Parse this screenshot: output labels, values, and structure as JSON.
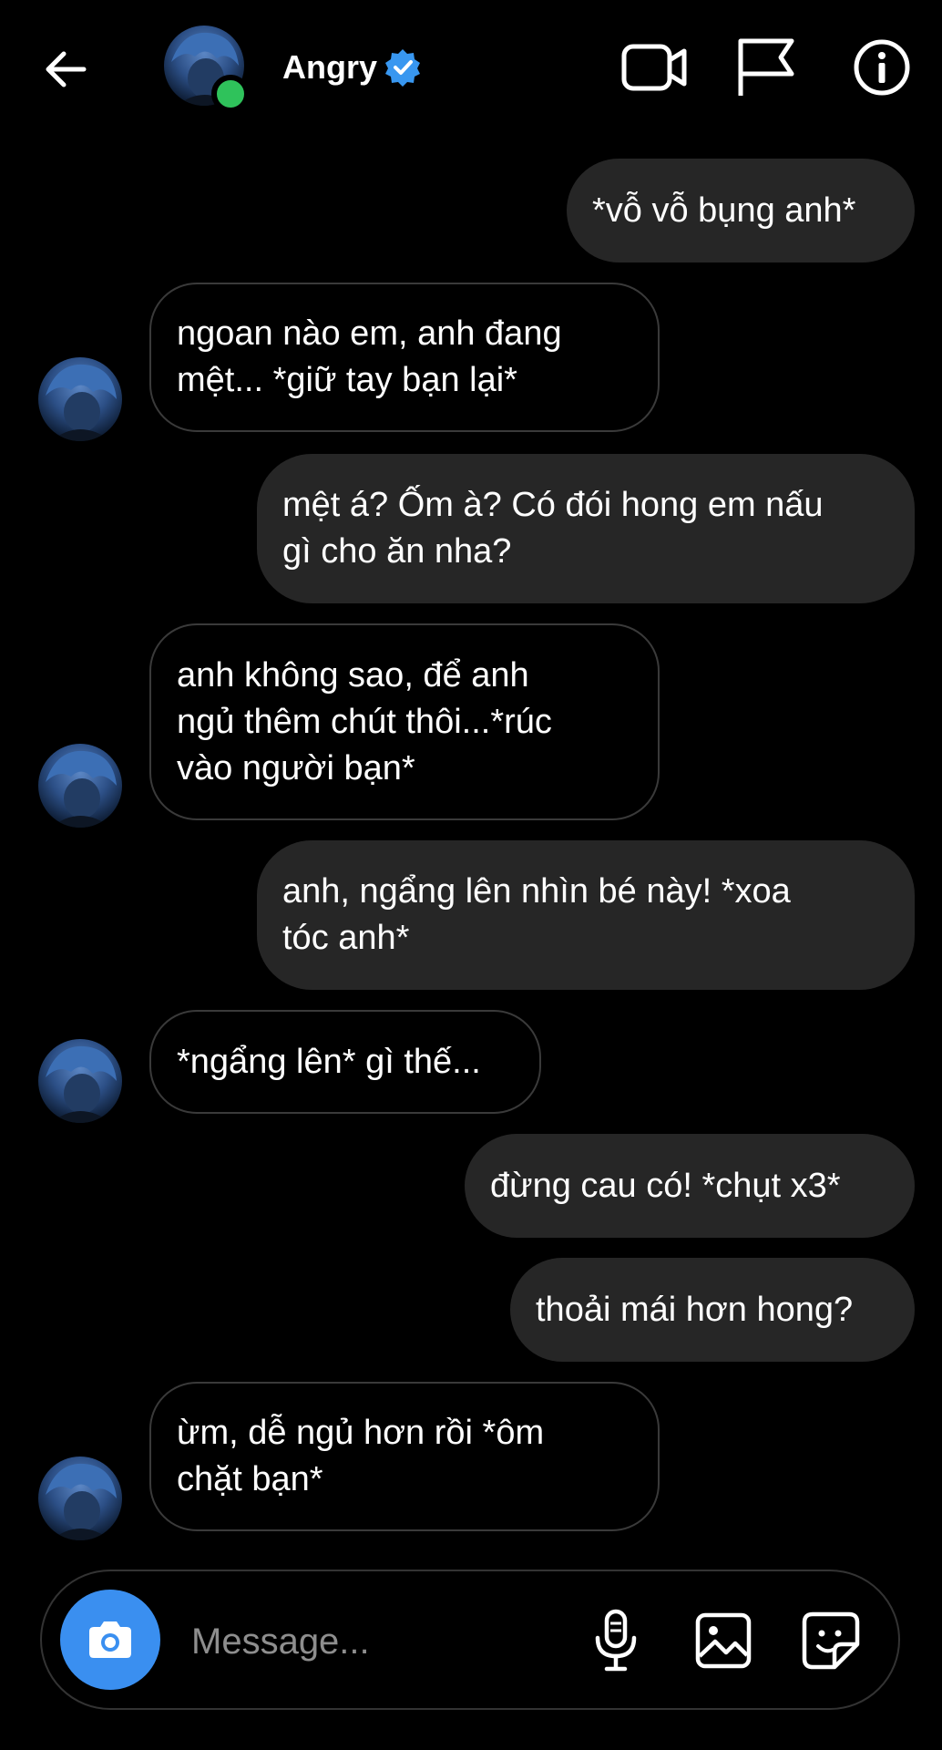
{
  "header": {
    "back_icon": "arrow-left-icon",
    "contact_name": "Angry",
    "verified_icon": "verified-badge-icon",
    "online_status_color": "#2fc25b",
    "video_icon": "video-camera-icon",
    "flag_icon": "flag-icon",
    "info_icon": "info-icon"
  },
  "messages": [
    {
      "direction": "sent",
      "text": "*vỗ vỗ bụng anh*"
    },
    {
      "direction": "received",
      "text": "ngoan nào em, anh đang\nmệt... *giữ tay bạn lại*"
    },
    {
      "direction": "sent",
      "text": "mệt á? Ốm à? Có đói hong em nấu\ngì cho ăn nha?"
    },
    {
      "direction": "received",
      "text": "anh không sao, để anh\nngủ thêm chút thôi...*rúc\nvào người bạn*"
    },
    {
      "direction": "sent",
      "text": "anh, ngẩng lên nhìn bé này! *xoa\ntóc anh*"
    },
    {
      "direction": "received",
      "text": "*ngẩng lên* gì thế..."
    },
    {
      "direction": "sent",
      "text": "đừng cau có! *chụt x3*"
    },
    {
      "direction": "sent",
      "text": "thoải mái hơn hong?"
    },
    {
      "direction": "received",
      "text": "ừm, dễ ngủ hơn rồi *ôm\nchặt bạn*"
    }
  ],
  "composer": {
    "placeholder": "Message...",
    "camera_icon": "camera-icon",
    "mic_icon": "microphone-icon",
    "gallery_icon": "image-gallery-icon",
    "sticker_icon": "sticker-icon",
    "accent_color": "#3a8ff0"
  },
  "colors": {
    "background": "#000000",
    "sent_bubble": "#262626",
    "received_border": "#3a3a3a",
    "verified": "#3897f0"
  }
}
